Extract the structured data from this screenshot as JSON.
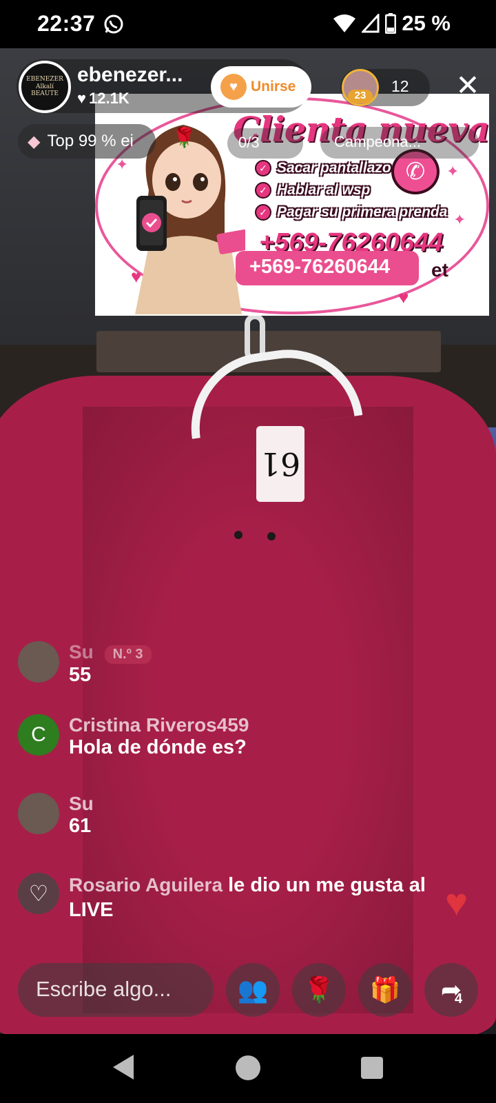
{
  "status": {
    "time": "22:37",
    "battery": "25 %",
    "icons": [
      "whatsapp-icon",
      "wifi-icon",
      "signal-icon",
      "battery-icon"
    ]
  },
  "host": {
    "name": "ebenezer...",
    "likes": "12.1K",
    "avatar_text": "EBENEZER Alkalí BEAUTE",
    "join_label": "Unirse"
  },
  "viewers": {
    "badge": "23",
    "count": "12"
  },
  "chips": {
    "rank": "Top 99 % ei",
    "goal": "0/3",
    "campeona": "Campeona..."
  },
  "promo": {
    "title": "Clienta nueva",
    "items": [
      "Sacar pantallazo",
      "Hablar al wsp",
      "Pagar su primera prenda"
    ],
    "phone_back": "+569-76260644",
    "phone": "+569-76260644",
    "fragment": "et"
  },
  "video": {
    "tag_number": "61"
  },
  "comments": [
    {
      "name": "Su",
      "badge": "N.º 3",
      "text": "55",
      "avatar_color": "#6a5a52"
    },
    {
      "name": "Cristina Riveros459",
      "badge": "",
      "text": "Hola de dónde es?",
      "avatar_letter": "C",
      "avatar_color": "#2e7d1f"
    },
    {
      "name": "Su",
      "badge": "",
      "text": "61",
      "avatar_color": "#6a5a52"
    },
    {
      "name": "Rosario Aguilera",
      "badge": "",
      "text": "le dio un me gusta al LIVE",
      "avatar_color": "rgba(70,70,70,0.8)"
    }
  ],
  "bottom": {
    "input_placeholder": "Escribe algo...",
    "share_count": "4"
  },
  "colors": {
    "accent": "#ea4e8e",
    "join": "#f08a2a",
    "sweater": "#a71f48"
  }
}
